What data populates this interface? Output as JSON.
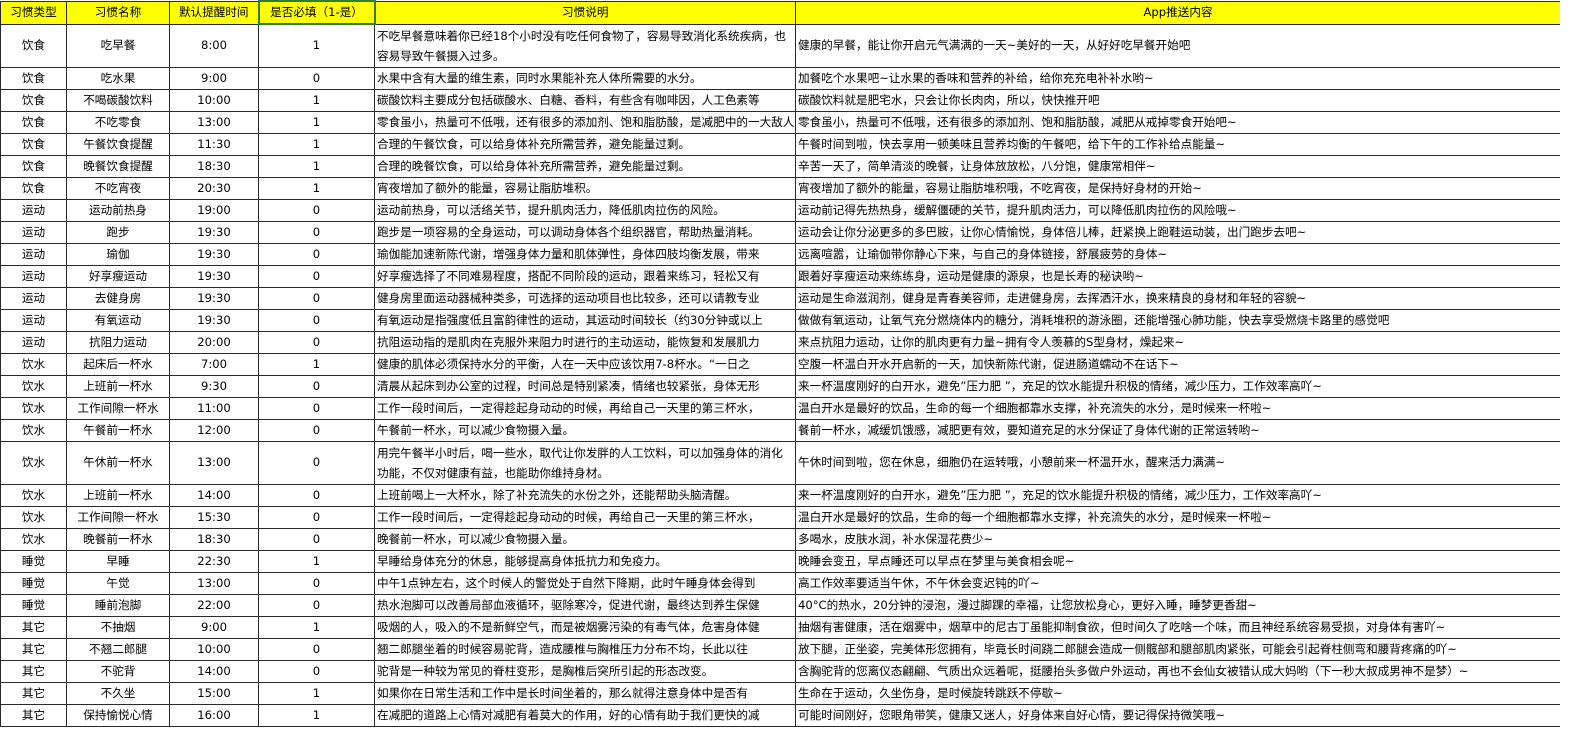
{
  "headers": [
    "习惯类型",
    "习惯名称",
    "默认提醒时间",
    "是否必填（1-是）",
    "习惯说明",
    "App推送内容"
  ],
  "rows": [
    [
      "饮食",
      "吃早餐",
      "8:00",
      "1",
      "不吃早餐意味着你已经18个小时没有吃任何食物了，容易导致消化系统疾病，也容易导致午餐摄入过多。",
      "健康的早餐，能让你开启元气满满的一天~美好的一天，从好好吃早餐开始吧"
    ],
    [
      "饮食",
      "吃水果",
      "9:00",
      "0",
      "水果中含有大量的维生素，同时水果能补充人体所需要的水分。",
      "加餐吃个水果吧~让水果的香味和营养的补给，给你充充电补补水哟~"
    ],
    [
      "饮食",
      "不喝碳酸饮料",
      "10:00",
      "1",
      "碳酸饮料主要成分包括碳酸水、白糖、香料，有些含有咖啡因，人工色素等",
      "碳酸饮料就是肥宅水，只会让你长肉肉，所以，快快推开吧"
    ],
    [
      "饮食",
      "不吃零食",
      "13:00",
      "1",
      "零食虽小，热量可不低哦，还有很多的添加剂、饱和脂肪酸，是减肥中的一大敌人",
      "零食虽小，热量可不低哦，还有很多的添加剂、饱和脂肪酸，减肥从戒掉零食开始吧~"
    ],
    [
      "饮食",
      "午餐饮食提醒",
      "11:30",
      "1",
      "合理的午餐饮食，可以给身体补充所需营养，避免能量过剩。",
      "午餐时间到啦，快去享用一顿美味且营养均衡的午餐吧，给下午的工作补给点能量~"
    ],
    [
      "饮食",
      "晚餐饮食提醒",
      "18:30",
      "1",
      "合理的晚餐饮食，可以给身体补充所需营养，避免能量过剩。",
      "辛苦一天了，简单清淡的晚餐，让身体放放松，八分饱，健康常相伴~"
    ],
    [
      "饮食",
      "不吃宵夜",
      "20:30",
      "1",
      "宵夜增加了额外的能量，容易让脂肪堆积。",
      "宵夜增加了额外的能量，容易让脂肪堆积哦，不吃宵夜，是保持好身材的开始~"
    ],
    [
      "运动",
      "运动前热身",
      "19:00",
      "0",
      "运动前热身，可以活络关节，提升肌肉活力，降低肌肉拉伤的风险。",
      "运动前记得先热热身，缓解僵硬的关节，提升肌肉活力，可以降低肌肉拉伤的风险哦~"
    ],
    [
      "运动",
      "跑步",
      "19:30",
      "0",
      "跑步是一项容易的全身运动，可以调动身体各个组织器官，帮助热量消耗。",
      "运动会让你分泌更多的多巴胺，让你心情愉悦，身体倍儿棒，赶紧换上跑鞋运动装，出门跑步去吧~"
    ],
    [
      "运动",
      "瑜伽",
      "19:30",
      "0",
      "瑜伽能加速新陈代谢，增强身体力量和肌体弹性，身体四肢均衡发展，带来",
      "远离喧嚣，让瑜伽带你静心下来，与自己的身体链接，舒展疲劳的身体~"
    ],
    [
      "运动",
      "好享瘦运动",
      "19:30",
      "0",
      "好享瘦选择了不同难易程度，搭配不同阶段的运动，跟着来练习，轻松又有",
      "跟着好享瘦运动来练练身，运动是健康的源泉，也是长寿的秘诀哟~"
    ],
    [
      "运动",
      "去健身房",
      "19:30",
      "0",
      "健身房里面运动器械种类多，可选择的运动项目也比较多，还可以请教专业",
      "运动是生命滋润剂，健身是青春美容师，走进健身房，去挥洒汗水，换来精良的身材和年轻的容貌~"
    ],
    [
      "运动",
      "有氧运动",
      "19:30",
      "0",
      "有氧运动是指强度低且富韵律性的运动，其运动时间较长（约30分钟或以上",
      "做做有氧运动，让氧气充分燃烧体内的糖分，消耗堆积的游泳圈，还能增强心肺功能，快去享受燃烧卡路里的感觉吧"
    ],
    [
      "运动",
      "抗阻力运动",
      "20:00",
      "0",
      "抗阻运动指的是肌肉在克服外来阻力时进行的主动运动，能恢复和发展肌力",
      "来点抗阻力运动，让你的肌肉更有力量~拥有令人羡慕的S型身材，燥起来~"
    ],
    [
      "饮水",
      "起床后一杯水",
      "7:00",
      "1",
      "健康的肌体必须保持水分的平衡，人在一天中应该饮用7-8杯水。“一日之",
      "空腹一杯温白开水开启新的一天，加快新陈代谢，促进肠道蠕动不在话下~"
    ],
    [
      "饮水",
      "上班前一杯水",
      "9:30",
      "0",
      "清晨从起床到办公室的过程，时间总是特别紧凑，情绪也较紧张，身体无形",
      "来一杯温度刚好的白开水，避免”压力肥 ”，充足的饮水能提升积极的情绪，减少压力，工作效率高吖~"
    ],
    [
      "饮水",
      "工作间隙一杯水",
      "11:00",
      "0",
      "工作一段时间后，一定得趁起身动动的时候，再给自己一天里的第三杯水，",
      "温白开水是最好的饮品，生命的每一个细胞都靠水支撑，补充流失的水分，是时候来一杯啦~"
    ],
    [
      "饮水",
      "午餐前一杯水",
      "12:00",
      "0",
      "午餐前一杯水，可以减少食物摄入量。",
      "餐前一杯水，减缓饥饿感，减肥更有效，要知道充足的水分保证了身体代谢的正常运转哟~"
    ],
    [
      "饮水",
      "午休前一杯水",
      "13:00",
      "0",
      "用完午餐半小时后，喝一些水，取代让你发胖的人工饮料，可以加强身体的消化功能，不仅对健康有益，也能助你维持身材。",
      "午休时间到啦，您在休息，细胞仍在运转哦，小憩前来一杯温开水，醒来活力满满~"
    ],
    [
      "饮水",
      "上班前一杯水",
      "14:00",
      "0",
      "上班前喝上一大杯水，除了补充流失的水份之外，还能帮助头脑清醒。",
      "来一杯温度刚好的白开水，避免”压力肥 ”，充足的饮水能提升积极的情绪，减少压力，工作效率高吖~"
    ],
    [
      "饮水",
      "工作间隙一杯水",
      "15:30",
      "0",
      "工作一段时间后，一定得趁起身动动的时候，再给自己一天里的第三杯水，",
      "温白开水是最好的饮品，生命的每一个细胞都靠水支撑，补充流失的水分，是时候来一杯啦~"
    ],
    [
      "饮水",
      "晚餐前一杯水",
      "18:30",
      "0",
      "晚餐前一杯水，可以减少食物摄入量。",
      "多喝水，皮肤水润，补水保湿花费少~"
    ],
    [
      "睡觉",
      "早睡",
      "22:30",
      "1",
      "早睡给身体充分的休息，能够提高身体抵抗力和免疫力。",
      "晚睡会变丑，早点睡还可以早点在梦里与美食相会呢~"
    ],
    [
      "睡觉",
      "午觉",
      "13:00",
      "0",
      "中午1点钟左右，这个时候人的警觉处于自然下降期，此时午睡身体会得到",
      "高工作效率要适当午休，不午休会变迟钝的吖~"
    ],
    [
      "睡觉",
      "睡前泡脚",
      "22:00",
      "0",
      "热水泡脚可以改善局部血液循环，驱除寒冷，促进代谢，最终达到养生保健",
      "40°C的热水，20分钟的浸泡，漫过脚踝的幸福，让您放松身心，更好入睡，睡梦更香甜~"
    ],
    [
      "其它",
      "不抽烟",
      "9:00",
      "1",
      "吸烟的人，吸入的不是新鲜空气，而是被烟雾污染的有毒气体，危害身体健",
      "抽烟有害健康，活在烟雾中，烟草中的尼古丁虽能抑制食欲，但时间久了吃啥一个味，而且神经系统容易受损，对身体有害吖~"
    ],
    [
      "其它",
      "不翘二郎腿",
      "10:00",
      "0",
      "翘二郎腿坐着的时候容易驼背，造成腰椎与胸椎压力分布不均，长此以往",
      "放下腿，正坐姿，完美体形您拥有，毕竟长时间跷二郎腿会造成一侧髋部和腿部肌肉紧张，可能会引起脊柱侧弯和腰背疼痛的吖~"
    ],
    [
      "其它",
      "不驼背",
      "14:00",
      "0",
      "驼背是一种较为常见的脊柱变形，是胸椎后突所引起的形态改变。",
      "含胸驼背的您离仪态翩翩、气质出众远着呢，挺腰抬头多做户外运动，再也不会仙女被错认成大妈哟（下一秒大叔成男神不是梦）~"
    ],
    [
      "其它",
      "不久坐",
      "15:00",
      "1",
      "如果你在日常生活和工作中是长时间坐着的，那么就得注意身体中是否有",
      "生命在于运动，久坐伤身，是时候旋转跳跃不停歇~"
    ],
    [
      "其它",
      "保持愉悦心情",
      "16:00",
      "1",
      "在减肥的道路上心情对减肥有着莫大的作用，好的心情有助于我们更快的减",
      "可能时间刚好，您眼角带笑，健康又迷人，好身体来自好心情，要记得保持微笑哦~"
    ]
  ]
}
